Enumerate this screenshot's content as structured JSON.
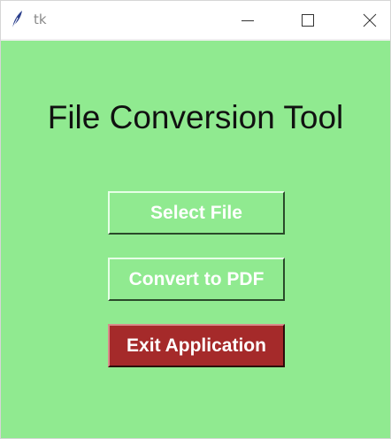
{
  "window": {
    "title": "tk",
    "icon": "tk-feather-icon",
    "controls": {
      "minimize_icon": "minimize-icon",
      "maximize_icon": "maximize-icon",
      "close_icon": "close-icon"
    }
  },
  "app": {
    "background_color": "#90ea90",
    "title": "File Conversion Tool",
    "buttons": {
      "select_file": "Select File",
      "convert_pdf": "Convert to PDF",
      "exit": "Exit Application"
    },
    "exit_button_color": "#a52a2a"
  }
}
